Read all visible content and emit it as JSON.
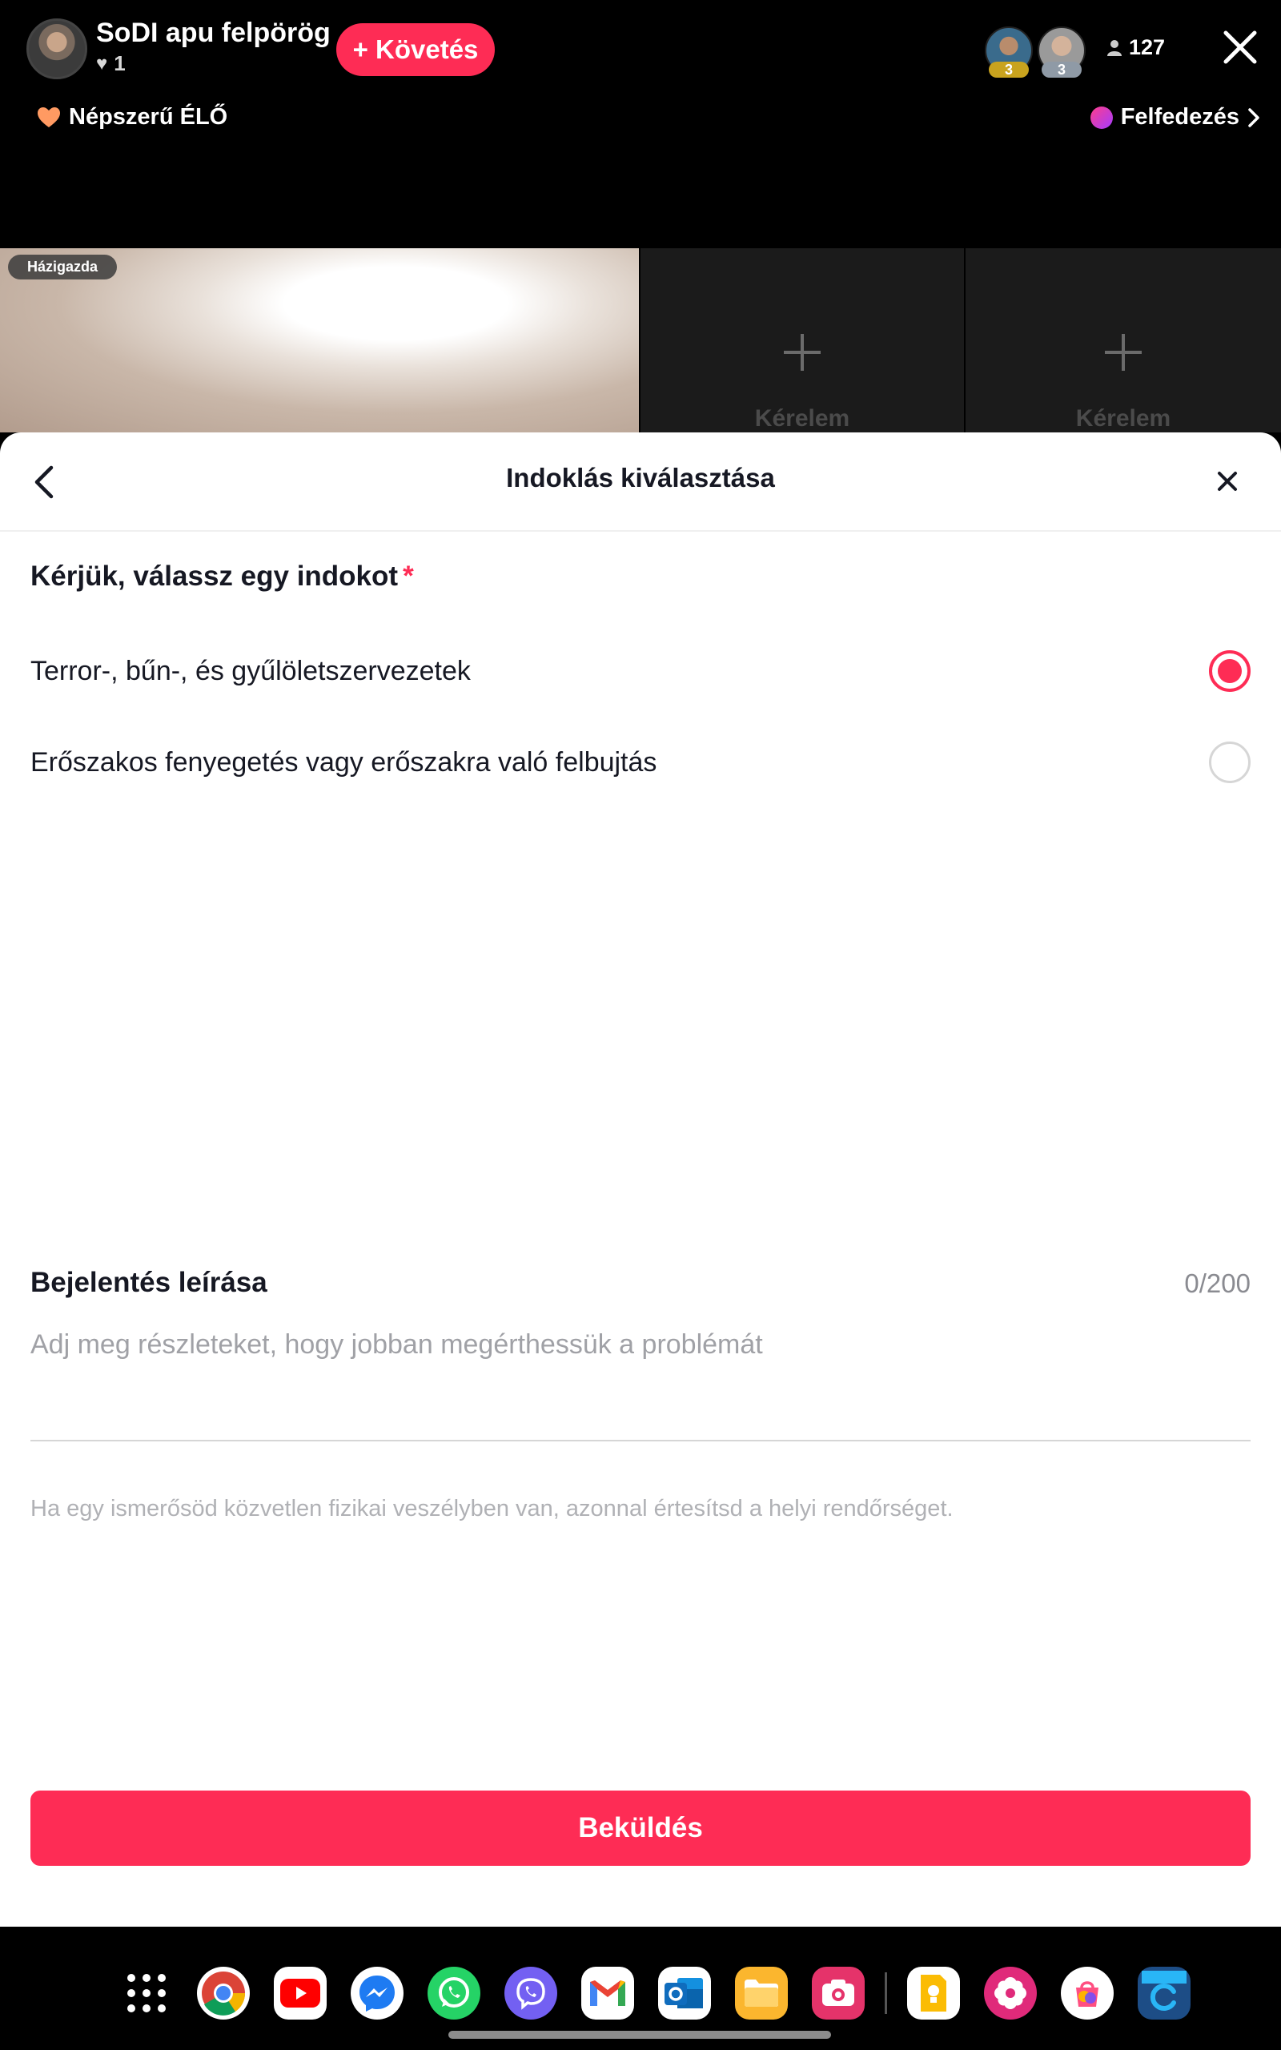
{
  "live": {
    "host_name": "SoDI apu felpörög",
    "likes": "1",
    "follow_label": "+ Követés",
    "viewers": [
      {
        "badge": "3",
        "badge_color": "#c9a31e"
      },
      {
        "badge": "3",
        "badge_color": "#8f9aa6"
      }
    ],
    "viewer_count": "127",
    "popular_label": "Népszerű ÉLŐ",
    "explore_label": "Felfedezés",
    "host_tag": "Házigazda",
    "slots": [
      {
        "label": "Kérelem"
      },
      {
        "label": "Kérelem"
      }
    ]
  },
  "sheet": {
    "title": "Indoklás kiválasztása",
    "question": "Kérjük, válassz egy indokot",
    "required_mark": "*",
    "options": [
      {
        "label": "Terror-, bűn-, és gyűlöletszervezetek",
        "selected": true
      },
      {
        "label": "Erőszakos fenyegetés vagy erőszakra való felbujtás",
        "selected": false
      }
    ],
    "description_title": "Bejelentés leírása",
    "char_count": "0/200",
    "description_placeholder": "Adj meg részleteket, hogy jobban megérthessük a problémát",
    "description_value": "",
    "warning": "Ha egy ismerősöd közvetlen fizikai veszélyben van, azonnal értesítsd a helyi rendőrséget.",
    "submit_label": "Beküldés"
  },
  "colors": {
    "accent": "#fe2c55",
    "text": "#161823",
    "muted": "#8a8b91"
  },
  "dock": {
    "apps": [
      "apps-grid-icon",
      "chrome-icon",
      "youtube-icon",
      "messenger-icon",
      "whatsapp-icon",
      "viber-icon",
      "gmail-icon",
      "outlook-icon",
      "files-icon",
      "screen-recorder-icon",
      "keep-icon",
      "blossom-icon",
      "galaxy-store-icon",
      "app-icon"
    ]
  }
}
